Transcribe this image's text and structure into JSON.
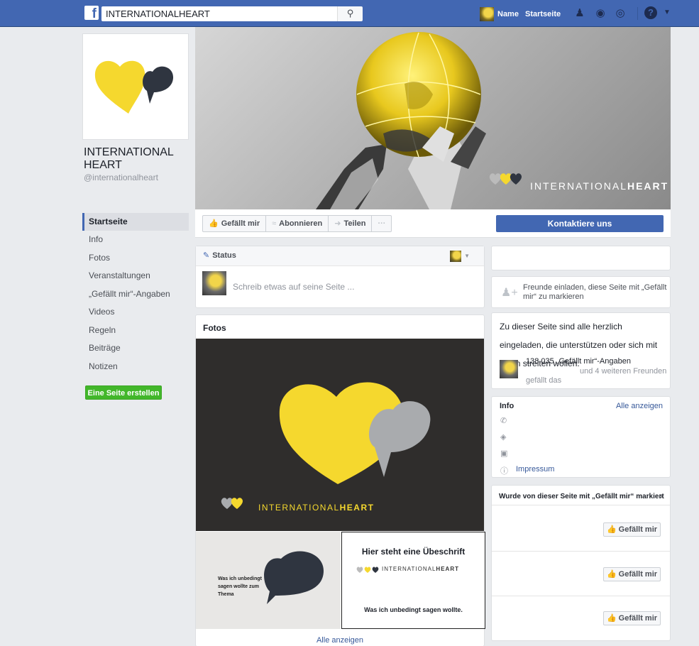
{
  "topbar": {
    "logo": "f",
    "search_value": "INTERNATIONALHEART",
    "search_icon": "search-icon",
    "user_name": "Name",
    "home_label": "Startseite",
    "help_label": "?"
  },
  "page": {
    "name": "INTERNATIONAL HEART",
    "handle": "@internationalheart",
    "brand_yellow": "#f5d82e",
    "brand_dark": "#2f3540"
  },
  "sidebar": {
    "items": [
      {
        "label": "Startseite"
      },
      {
        "label": "Info"
      },
      {
        "label": "Fotos"
      },
      {
        "label": "Veranstaltungen"
      },
      {
        "label": "„Gefällt mir“-Angaben"
      },
      {
        "label": "Videos"
      },
      {
        "label": "Regeln"
      },
      {
        "label": "Beiträge"
      },
      {
        "label": "Notizen"
      }
    ],
    "create_page": "Eine Seite erstellen"
  },
  "cover": {
    "logo_text_light": "INTERNATIONAL",
    "logo_text_bold": "HEART"
  },
  "actions": {
    "like": "Gefällt mir",
    "subscribe": "Abonnieren",
    "share": "Teilen",
    "more": "···",
    "contact": "Kontaktiere uns"
  },
  "composer": {
    "tab": "Status",
    "placeholder": "Schreib etwas auf seine Seite ..."
  },
  "photos": {
    "title": "Fotos",
    "main_logo_light": "INTERNATIONAL",
    "main_logo_bold": "HEART",
    "bl_text": "Was ich unbedingt sagen wollte zum Thema",
    "br_title": "Hier steht eine Übeschrift",
    "br_logo_light": "INTERNATIONAL",
    "br_logo_bold": "HEART",
    "br_sub": "Was ich unbedingt sagen wollte.",
    "see_all": "Alle anzeigen"
  },
  "right": {
    "invite_text": "Freunde einladen, diese Seite mit „Gefällt mir“ zu markieren",
    "about_text": "Zu dieser Seite sind alle herzlich eingeladen, die unterstützen oder sich mit ihnen streiten wollen.",
    "likes": "138.035 „Gefällt mir“-Angaben",
    "friends": "und 4 weiteren Freunden",
    "gefaellt_das": "gefällt das",
    "info_title": "Info",
    "info_all": "Alle anzeigen",
    "impressum": "Impressum",
    "liked_title": "Wurde von dieser Seite mit „Gefällt mir“ markiert",
    "like_button": "Gefällt mir"
  }
}
